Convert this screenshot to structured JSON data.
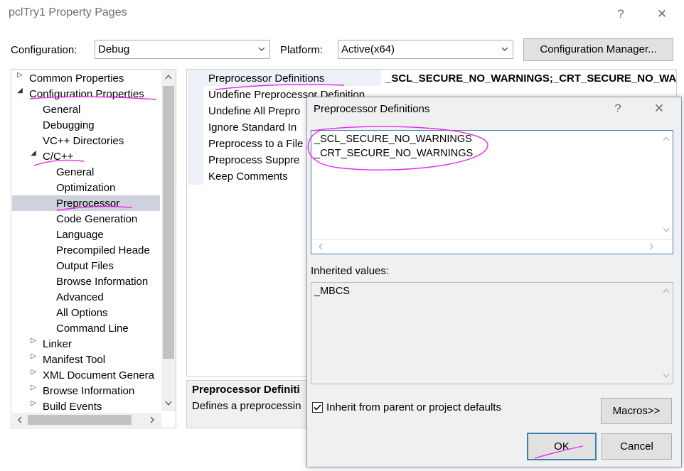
{
  "window": {
    "title": "pclTry1 Property Pages",
    "help": "?",
    "close": "✕"
  },
  "config_bar": {
    "configuration_label": "Configuration:",
    "configuration_value": "Debug",
    "platform_label": "Platform:",
    "platform_value": "Active(x64)",
    "manager_button": "Configuration Manager..."
  },
  "tree": {
    "common": "Common Properties",
    "config": "Configuration Properties",
    "general": "General",
    "debugging": "Debugging",
    "vcdirs": "VC++ Directories",
    "cpp": "C/C++",
    "cpp_items": [
      "General",
      "Optimization",
      "Preprocessor",
      "Code Generation",
      "Language",
      "Precompiled Heade",
      "Output Files",
      "Browse Information",
      "Advanced",
      "All Options",
      "Command Line"
    ],
    "linker": "Linker",
    "manifest": "Manifest Tool",
    "xmldoc": "XML Document Genera",
    "browse": "Browse Information",
    "build": "Build Events"
  },
  "properties": {
    "rows": [
      "Preprocessor Definitions",
      "Undefine Preprocessor Definition",
      "Undefine All Prepro",
      "Ignore Standard In",
      "Preprocess to a File",
      "Preprocess Suppre",
      "Keep Comments"
    ],
    "first_value": "_SCL_SECURE_NO_WARNINGS;_CRT_SECURE_NO_WAR",
    "desc_title": "Preprocessor Definiti",
    "desc_text": "Defines a preprocessin"
  },
  "dialog": {
    "title": "Preprocessor Definitions",
    "help": "?",
    "close": "✕",
    "definitions": [
      "_SCL_SECURE_NO_WARNINGS",
      "_CRT_SECURE_NO_WARNINGS"
    ],
    "inherited_label": "Inherited values:",
    "inherited_values": [
      "_MBCS"
    ],
    "inherit_checkbox_label": "Inherit from parent or project defaults",
    "inherit_checked": true,
    "macros_button": "Macros>>",
    "ok_button": "OK",
    "cancel_button": "Cancel"
  },
  "colors": {
    "annotation": "#e62be6",
    "selection": "#cfd2dd",
    "accent_border": "#3c7fb1"
  }
}
